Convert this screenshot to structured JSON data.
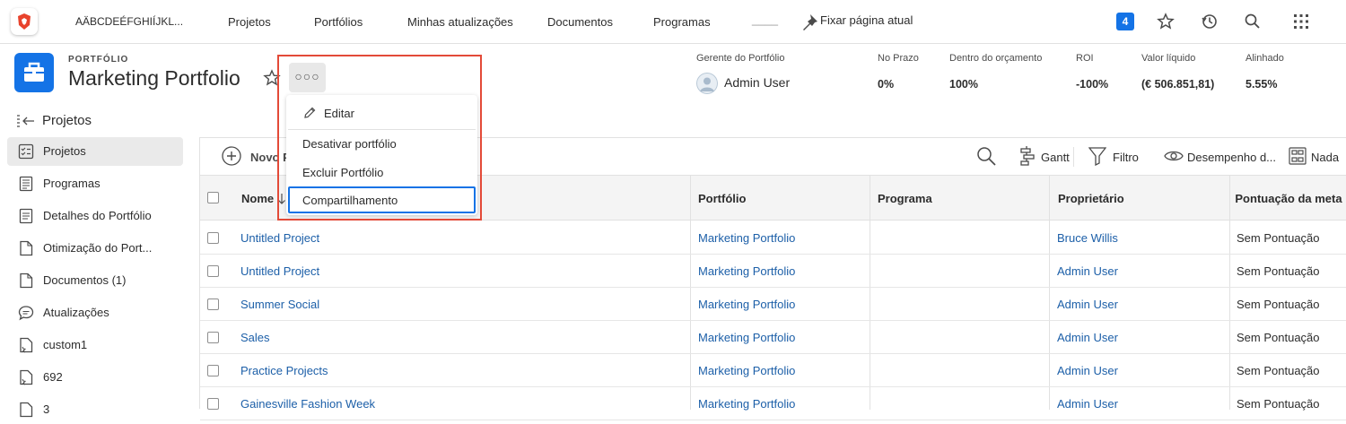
{
  "topnav": {
    "app_name": "AÄBCDEÉFGHIÍJKL...",
    "items": [
      "Projetos",
      "Portfólios",
      "Minhas atualizações",
      "Documentos",
      "Programas"
    ],
    "blank_item": "____",
    "pin_label": "Fixar página atual",
    "notifications_count": "4"
  },
  "header": {
    "eyebrow": "PORTFÓLIO",
    "title": "Marketing Portfolio",
    "more_label": "○○○",
    "metrics": [
      {
        "label": "Gerente do Portfólio",
        "value": "Admin User"
      },
      {
        "label": "No Prazo",
        "value": "0%"
      },
      {
        "label": "Dentro do orçamento",
        "value": "100%"
      },
      {
        "label": "ROI",
        "value": "-100%"
      },
      {
        "label": "Valor líquido",
        "value": "(€ 506.851,81)"
      },
      {
        "label": "Alinhado",
        "value": "5.55%"
      }
    ]
  },
  "sidebar": {
    "heading": "Projetos",
    "items": [
      {
        "label": "Projetos",
        "icon": "projects-icon"
      },
      {
        "label": "Programas",
        "icon": "programs-icon"
      },
      {
        "label": "Detalhes do Portfólio",
        "icon": "details-icon"
      },
      {
        "label": "Otimização do Port...",
        "icon": "optimizer-icon"
      },
      {
        "label": "Documentos (1)",
        "icon": "document-icon"
      },
      {
        "label": "Atualizações",
        "icon": "chat-icon"
      },
      {
        "label": "custom1",
        "icon": "custom-tab-icon"
      },
      {
        "label": "692",
        "icon": "custom-tab-icon"
      },
      {
        "label": "3",
        "icon": "custom-tab-icon"
      }
    ]
  },
  "toolbar": {
    "new_label": "Novo P",
    "gantt": "Gantt",
    "filter": "Filtro",
    "view": "Desempenho d...",
    "group": "Nada"
  },
  "menu": {
    "items": [
      "Editar",
      "Desativar portfólio",
      "Excluir Portfólio",
      "Compartilhamento"
    ]
  },
  "table": {
    "columns": [
      "Nome",
      "Portfólio",
      "Programa",
      "Proprietário",
      "Pontuação da meta"
    ],
    "rows": [
      {
        "name": "Untitled Project",
        "portfolio": "Marketing Portfolio",
        "program": "",
        "owner": "Bruce Willis",
        "score": "Sem Pontuação"
      },
      {
        "name": "Untitled Project",
        "portfolio": "Marketing Portfolio",
        "program": "",
        "owner": "Admin User",
        "score": "Sem Pontuação"
      },
      {
        "name": "Summer Social",
        "portfolio": "Marketing Portfolio",
        "program": "",
        "owner": "Admin User",
        "score": "Sem Pontuação"
      },
      {
        "name": "Sales",
        "portfolio": "Marketing Portfolio",
        "program": "",
        "owner": "Admin User",
        "score": "Sem Pontuação"
      },
      {
        "name": "Practice Projects",
        "portfolio": "Marketing Portfolio",
        "program": "",
        "owner": "Admin User",
        "score": "Sem Pontuação"
      },
      {
        "name": "Gainesville Fashion Week",
        "portfolio": "Marketing Portfolio",
        "program": "",
        "owner": "Admin User",
        "score": "Sem Pontuação"
      }
    ]
  },
  "colors": {
    "accent": "#1473e6",
    "link": "#1c5fa8",
    "highlight": "#e34a38"
  }
}
